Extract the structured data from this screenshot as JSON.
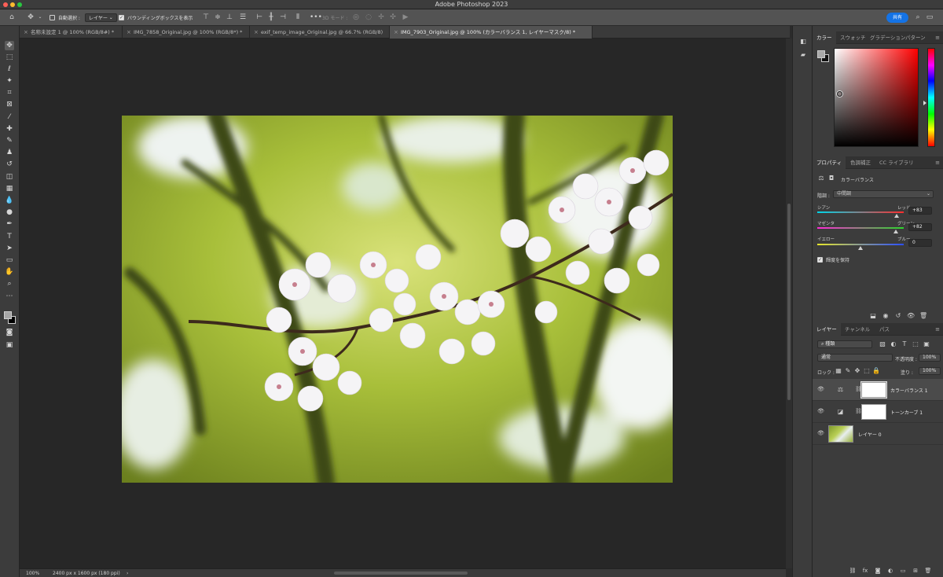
{
  "app": {
    "title": "Adobe Photoshop 2023"
  },
  "options_bar": {
    "auto_select_label": "自動選択 :",
    "auto_select_value": "レイヤー",
    "show_bbox_label": "バウンディングボックスを表示",
    "mode_3d_label": "3D モード :",
    "share_label": "共有"
  },
  "doc_tabs": [
    {
      "label": "名称未設定 1 @ 100% (RGB/8#) *"
    },
    {
      "label": "IMG_7858_Original.jpg @ 100% (RGB/8*) *"
    },
    {
      "label": "exif_temp_image_Original.jpg @ 66.7% (RGB/8)"
    },
    {
      "label": "IMG_7903_Original.jpg @ 100% (カラーバランス 1, レイヤーマスク/8) *"
    }
  ],
  "status": {
    "zoom": "100%",
    "doc_info": "2400 px x 1600 px (180 ppi)",
    "arrow": "›"
  },
  "color_panel": {
    "tabs": [
      "カラー",
      "スウォッチ",
      "グラデーション",
      "パターン"
    ],
    "fg_color": "#a9a9a9",
    "bg_color": "#111111"
  },
  "properties_panel": {
    "tabs": [
      "プロパティ",
      "色調補正",
      "CC ライブラリ"
    ],
    "adjustment_title": "カラーバランス",
    "tone_label": "階調 :",
    "tone_value": "中間調",
    "sliders": [
      {
        "left": "シアン",
        "right": "レッド",
        "value": "+83",
        "position": 0.915
      },
      {
        "left": "マゼンタ",
        "right": "グリーン",
        "value": "+82",
        "position": 0.91
      },
      {
        "left": "イエロー",
        "right": "ブルー",
        "value": "0",
        "position": 0.5
      }
    ],
    "preserve_luminosity": "輝度を保持"
  },
  "layers_panel": {
    "tabs": [
      "レイヤー",
      "チャンネル",
      "パス"
    ],
    "filter_kind": "種類",
    "blend_mode": "通常",
    "opacity_label": "不透明度 :",
    "opacity_value": "100%",
    "lock_label": "ロック :",
    "fill_label": "塗り :",
    "fill_value": "100%",
    "layers": [
      {
        "name": "カラーバランス 1",
        "type": "color-balance"
      },
      {
        "name": "トーンカーブ 1",
        "type": "curves"
      },
      {
        "name": "レイヤー 0",
        "type": "pixel"
      }
    ]
  }
}
